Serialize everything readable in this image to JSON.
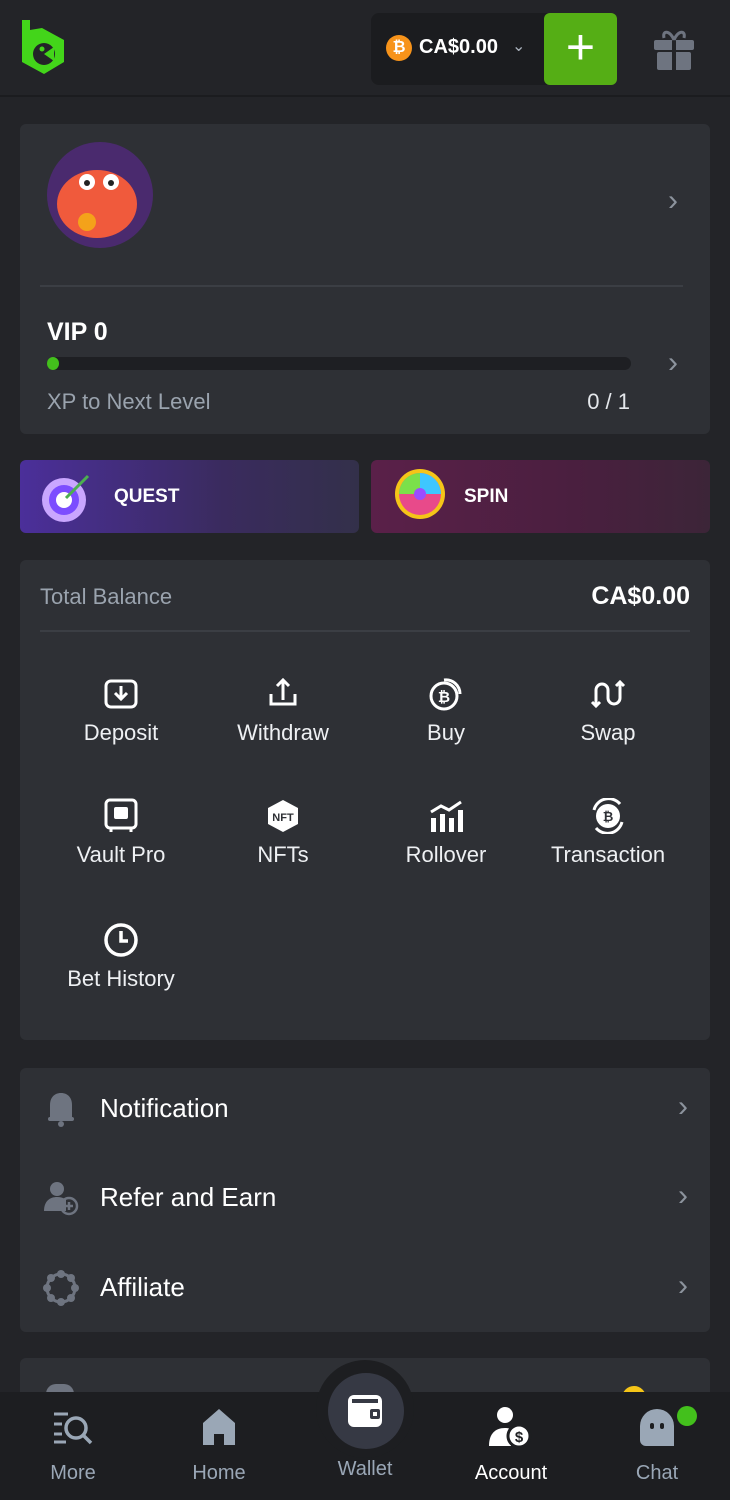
{
  "header": {
    "balance": "CA$0.00",
    "currency_icon": "bitcoin-icon",
    "deposit_icon": "plus-icon",
    "gift_icon": "gift-icon"
  },
  "profile": {
    "vip_label": "VIP 0",
    "xp_label": "XP to Next Level",
    "xp_value": "0 / 1",
    "progress": 0
  },
  "promos": [
    {
      "label": "QUEST"
    },
    {
      "label": "SPIN"
    }
  ],
  "wallet": {
    "title": "Total Balance",
    "total": "CA$0.00",
    "actions": [
      {
        "label": "Deposit"
      },
      {
        "label": "Withdraw"
      },
      {
        "label": "Buy"
      },
      {
        "label": "Swap"
      },
      {
        "label": "Vault Pro"
      },
      {
        "label": "NFTs"
      },
      {
        "label": "Rollover"
      },
      {
        "label": "Transaction"
      },
      {
        "label": "Bet History"
      }
    ]
  },
  "menu": [
    {
      "label": "Notification"
    },
    {
      "label": "Refer and Earn"
    },
    {
      "label": "Affiliate"
    }
  ],
  "nav": [
    {
      "label": "More"
    },
    {
      "label": "Home"
    },
    {
      "label": "Wallet"
    },
    {
      "label": "Account"
    },
    {
      "label": "Chat"
    }
  ],
  "colors": {
    "accent": "#55ae15",
    "background": "#232428",
    "card": "#2e3035"
  }
}
